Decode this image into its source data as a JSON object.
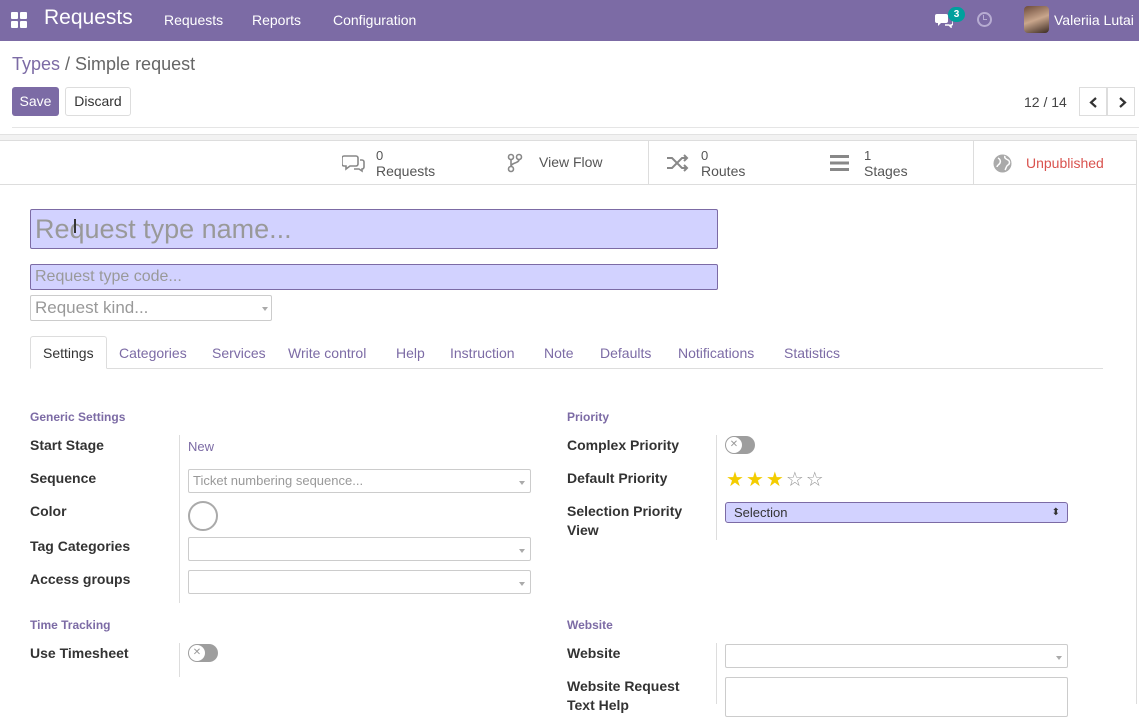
{
  "navbar": {
    "app_title": "Requests",
    "menu": [
      "Requests",
      "Reports",
      "Configuration"
    ],
    "chat_badge": "3",
    "user_name": "Valeriia Lutai",
    "bg_color": "#7c6ba5"
  },
  "breadcrumb": {
    "parent": "Types",
    "separator": " / ",
    "current": "Simple request"
  },
  "actions": {
    "save_label": "Save",
    "discard_label": "Discard"
  },
  "pager": {
    "text": "12 / 14"
  },
  "stat_buttons": [
    {
      "count": "0",
      "label": "Requests",
      "icon": "comments-icon"
    },
    {
      "count": "",
      "label": "View Flow",
      "icon": "code-fork-icon"
    },
    {
      "count": "0",
      "label": "Routes",
      "icon": "random-icon"
    },
    {
      "count": "1",
      "label": "Stages",
      "icon": "bars-icon"
    },
    {
      "count": "",
      "label": "Unpublished",
      "icon": "globe-icon"
    }
  ],
  "form": {
    "name_placeholder": "Request type name...",
    "code_placeholder": "Request type code...",
    "kind_placeholder": "Request kind..."
  },
  "tabs": [
    "Settings",
    "Categories",
    "Services",
    "Write control",
    "Help",
    "Instruction",
    "Note",
    "Defaults",
    "Notifications",
    "Statistics"
  ],
  "generic_settings": {
    "title": "Generic Settings",
    "start_stage_label": "Start Stage",
    "start_stage_value": "New",
    "sequence_label": "Sequence",
    "sequence_placeholder": "Ticket numbering sequence...",
    "color_label": "Color",
    "tag_categories_label": "Tag Categories",
    "access_groups_label": "Access groups"
  },
  "priority": {
    "title": "Priority",
    "complex_label": "Complex Priority",
    "default_label": "Default Priority",
    "default_stars": 3,
    "max_stars": 5,
    "selection_view_label_1": "Selection Priority",
    "selection_view_label_2": "View",
    "selection_view_value": "Selection"
  },
  "time_tracking": {
    "title": "Time Tracking",
    "timesheet_label": "Use Timesheet"
  },
  "website": {
    "title": "Website",
    "website_label": "Website",
    "help_label_1": "Website Request",
    "help_label_2": "Text Help"
  }
}
